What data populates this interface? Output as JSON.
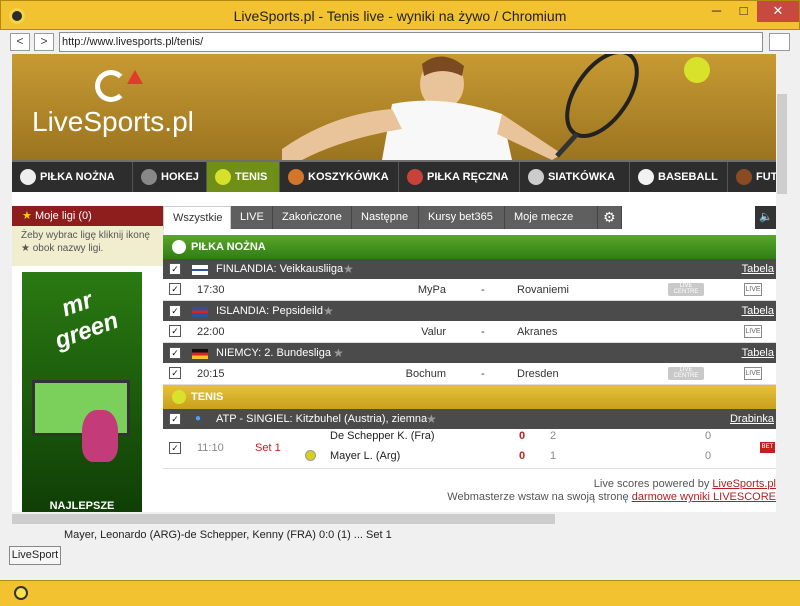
{
  "window": {
    "title": "LiveSports.pl - Tenis live - wyniki na żywo / Chromium",
    "minimize": "─",
    "maximize": "□",
    "close": "✕"
  },
  "nav": {
    "back": "<",
    "forward": ">",
    "url": "http://www.livesports.pl/tenis/"
  },
  "site": {
    "logo": "LiveSports.pl"
  },
  "menu": [
    {
      "label": "PIŁKA NOŻNA",
      "icon": "soccer-ball-icon"
    },
    {
      "label": "HOKEJ",
      "icon": "hockey-puck-icon"
    },
    {
      "label": "TENIS",
      "icon": "tennis-ball-icon"
    },
    {
      "label": "KOSZYKÓWKA",
      "icon": "basketball-icon"
    },
    {
      "label": "PIŁKA RĘCZNA",
      "icon": "handball-icon"
    },
    {
      "label": "SIATKÓWKA",
      "icon": "volleyball-icon"
    },
    {
      "label": "BASEBALL",
      "icon": "baseball-icon"
    },
    {
      "label": "FUT",
      "icon": "football-icon"
    }
  ],
  "sidebar": {
    "my_leagues": "Moje ligi (0)",
    "note": "Żeby wybrac ligę kliknij ikonę ★ obok nazwy ligi.",
    "ad_brand": "mr green",
    "ad_slogan": "NAJLEPSZE"
  },
  "tabs": [
    "Wszystkie",
    "LIVE",
    "Zakończone",
    "Następne",
    "Kursy bet365",
    "Moje mecze (4)"
  ],
  "sports": {
    "football": "PIŁKA NOŻNA",
    "tennis": "TENIS"
  },
  "leagues": [
    {
      "name": "FINLANDIA: Veikkausliiga",
      "link": "Tabela"
    },
    {
      "name": "ISLANDIA: Pepsideild",
      "link": "Tabela"
    },
    {
      "name": "NIEMCY: 2. Bundesliga",
      "link": "Tabela"
    },
    {
      "name": "ATP - SINGIEL: Kitzbuhel (Austria), ziemna",
      "link": "Drabinka"
    }
  ],
  "matches": [
    {
      "time": "17:30",
      "home": "MyPa",
      "dash": "-",
      "away": "Rovaniemi",
      "live_centre": "LIVE CENTRE",
      "tv": "LIVE"
    },
    {
      "time": "22:00",
      "home": "Valur",
      "dash": "-",
      "away": "Akranes",
      "tv": "LIVE"
    },
    {
      "time": "20:15",
      "home": "Bochum",
      "dash": "-",
      "away": "Dresden",
      "live_centre": "LIVE CENTRE",
      "tv": "LIVE"
    }
  ],
  "tennis_match": {
    "time": "11:10",
    "status": "Set 1",
    "player1": "De Schepper K. (Fra)",
    "player2": "Mayer L. (Arg)",
    "p1_sets": "0",
    "p1_games": "2",
    "p1_points": "0",
    "p2_sets": "0",
    "p2_games": "1",
    "p2_points": "0",
    "bet_label": "BET"
  },
  "footer": {
    "powered_prefix": "Live scores powered by ",
    "powered_link": "LiveSports.pl",
    "webmaster_prefix": "Webmasterze wstaw na swoją stronę ",
    "webmaster_link": "darmowe wyniki LIVESCORE"
  },
  "statusbar": "Mayer, Leonardo (ARG)-de Schepper, Kenny (FRA) 0:0 (1) ...  Set 1",
  "bottom_button": "LiveSport"
}
